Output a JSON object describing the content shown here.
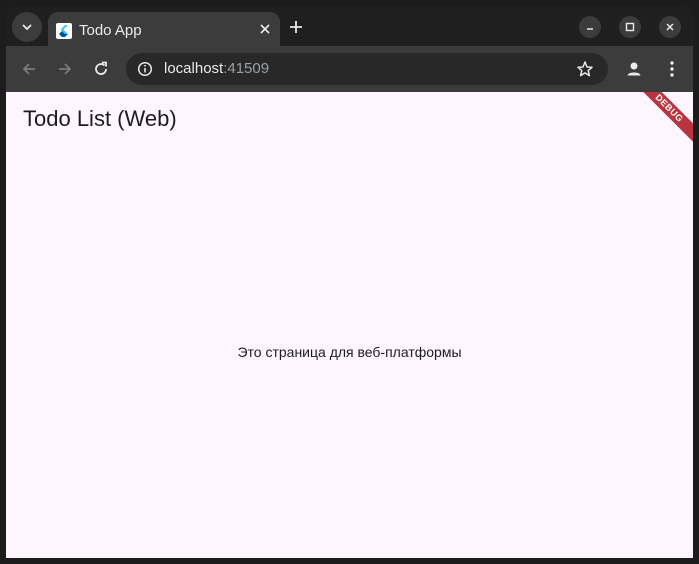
{
  "browser": {
    "tab_title": "Todo App",
    "url_host": "localhost",
    "url_port": ":41509"
  },
  "page": {
    "app_title": "Todo List (Web)",
    "center_message": "Это страница для веб-платформы",
    "debug_label": "DEBUG"
  },
  "icons": {
    "tab_search": "chevron-down-icon",
    "favicon": "flutter-icon",
    "tab_close": "close-icon",
    "new_tab": "plus-icon",
    "minimize": "minimize-icon",
    "maximize": "maximize-icon",
    "close_window": "close-icon",
    "back": "arrow-left-icon",
    "forward": "arrow-right-icon",
    "reload": "reload-icon",
    "site_info": "info-icon",
    "bookmark": "star-icon",
    "profile": "person-icon",
    "menu": "kebab-menu-icon"
  },
  "colors": {
    "page_background": "#fdf6fe",
    "browser_chrome": "#3c3c3c",
    "debug_banner": "#b7353f"
  }
}
